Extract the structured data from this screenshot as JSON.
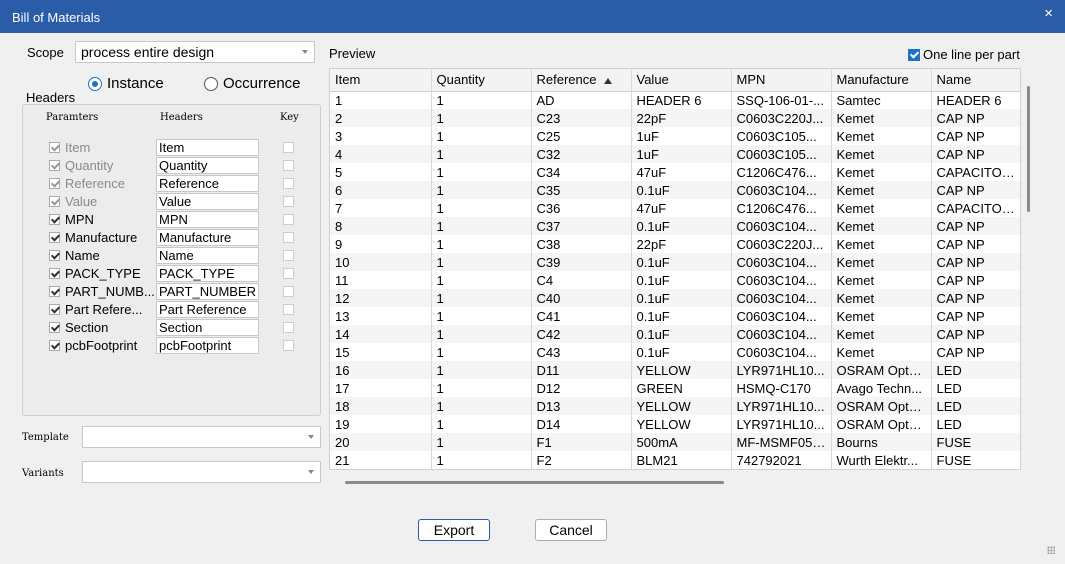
{
  "window": {
    "title": "Bill of Materials",
    "close": "×"
  },
  "scope": {
    "label": "Scope",
    "value": "process entire design"
  },
  "mode": {
    "instance": "Instance",
    "occurrence": "Occurrence",
    "selected": "instance"
  },
  "headers_panel": {
    "title": "Headers",
    "col_params": "Paramters",
    "col_headers": "Headers",
    "col_key": "Key",
    "rows": [
      {
        "param": "Item",
        "header": "Item",
        "checked": true,
        "disabled": true
      },
      {
        "param": "Quantity",
        "header": "Quantity",
        "checked": true,
        "disabled": true
      },
      {
        "param": "Reference",
        "header": "Reference",
        "checked": true,
        "disabled": true
      },
      {
        "param": "Value",
        "header": "Value",
        "checked": true,
        "disabled": true
      },
      {
        "param": "MPN",
        "header": "MPN",
        "checked": true,
        "disabled": false
      },
      {
        "param": "Manufacture",
        "header": "Manufacture",
        "checked": true,
        "disabled": false
      },
      {
        "param": "Name",
        "header": "Name",
        "checked": true,
        "disabled": false
      },
      {
        "param": "PACK_TYPE",
        "header": "PACK_TYPE",
        "checked": true,
        "disabled": false
      },
      {
        "param": "PART_NUMB...",
        "header": "PART_NUMBER",
        "checked": true,
        "disabled": false
      },
      {
        "param": "Part Refere...",
        "header": "Part Reference",
        "checked": true,
        "disabled": false
      },
      {
        "param": "Section",
        "header": "Section",
        "checked": true,
        "disabled": false
      },
      {
        "param": "pcbFootprint",
        "header": "pcbFootprint",
        "checked": true,
        "disabled": false
      }
    ]
  },
  "template": {
    "label": "Template",
    "value": ""
  },
  "variants": {
    "label": "Variants",
    "value": ""
  },
  "preview": {
    "label": "Preview",
    "one_line_label": "One line per part",
    "one_line_checked": true,
    "columns": [
      "Item",
      "Quantity",
      "Reference",
      "Value",
      "MPN",
      "Manufacture",
      "Name"
    ],
    "sort_column": "Reference",
    "rows": [
      [
        "1",
        "1",
        "AD",
        "HEADER 6",
        "SSQ-106-01-...",
        "Samtec",
        "HEADER 6"
      ],
      [
        "2",
        "1",
        "C23",
        "22pF",
        "C0603C220J...",
        "Kemet",
        "CAP NP"
      ],
      [
        "3",
        "1",
        "C25",
        "1uF",
        "C0603C105...",
        "Kemet",
        "CAP NP"
      ],
      [
        "4",
        "1",
        "C32",
        "1uF",
        "C0603C105...",
        "Kemet",
        "CAP NP"
      ],
      [
        "5",
        "1",
        "C34",
        "47uF",
        "C1206C476...",
        "Kemet",
        "CAPACITOR ..."
      ],
      [
        "6",
        "1",
        "C35",
        "0.1uF",
        "C0603C104...",
        "Kemet",
        "CAP NP"
      ],
      [
        "7",
        "1",
        "C36",
        "47uF",
        "C1206C476...",
        "Kemet",
        "CAPACITOR ..."
      ],
      [
        "8",
        "1",
        "C37",
        "0.1uF",
        "C0603C104...",
        "Kemet",
        "CAP NP"
      ],
      [
        "9",
        "1",
        "C38",
        "22pF",
        "C0603C220J...",
        "Kemet",
        "CAP NP"
      ],
      [
        "10",
        "1",
        "C39",
        "0.1uF",
        "C0603C104...",
        "Kemet",
        "CAP NP"
      ],
      [
        "11",
        "1",
        "C4",
        "0.1uF",
        "C0603C104...",
        "Kemet",
        "CAP NP"
      ],
      [
        "12",
        "1",
        "C40",
        "0.1uF",
        "C0603C104...",
        "Kemet",
        "CAP NP"
      ],
      [
        "13",
        "1",
        "C41",
        "0.1uF",
        "C0603C104...",
        "Kemet",
        "CAP NP"
      ],
      [
        "14",
        "1",
        "C42",
        "0.1uF",
        "C0603C104...",
        "Kemet",
        "CAP NP"
      ],
      [
        "15",
        "1",
        "C43",
        "0.1uF",
        "C0603C104...",
        "Kemet",
        "CAP NP"
      ],
      [
        "16",
        "1",
        "D11",
        "YELLOW",
        "LYR971HL10...",
        "OSRAM Opto...",
        "LED"
      ],
      [
        "17",
        "1",
        "D12",
        "GREEN",
        "HSMQ-C170",
        "Avago Techn...",
        "LED"
      ],
      [
        "18",
        "1",
        "D13",
        "YELLOW",
        "LYR971HL10...",
        "OSRAM Opto...",
        "LED"
      ],
      [
        "19",
        "1",
        "D14",
        "YELLOW",
        "LYR971HL10...",
        "OSRAM Opto...",
        "LED"
      ],
      [
        "20",
        "1",
        "F1",
        "500mA",
        "MF-MSMF050...",
        "Bourns",
        "FUSE"
      ],
      [
        "21",
        "1",
        "F2",
        "BLM21",
        "742792021",
        "Wurth Elektr...",
        "FUSE"
      ]
    ]
  },
  "buttons": {
    "export": "Export",
    "cancel": "Cancel"
  }
}
